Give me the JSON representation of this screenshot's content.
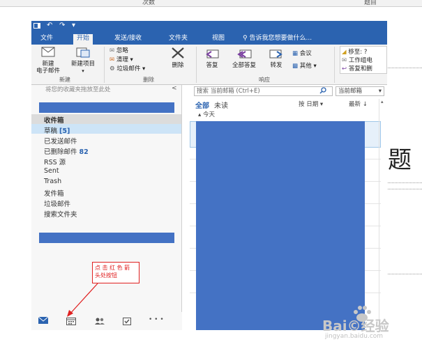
{
  "top_strip": {
    "left_text": "次数",
    "right_text": "题目"
  },
  "title_bar": {
    "icons": [
      "↶",
      "↷",
      "▾"
    ]
  },
  "tabs": [
    {
      "label": "文件",
      "active": false
    },
    {
      "label": "开始",
      "active": true
    },
    {
      "label": "发送/接收",
      "active": false
    },
    {
      "label": "文件夹",
      "active": false
    },
    {
      "label": "视图",
      "active": false
    },
    {
      "label": "告诉我您想要做什么...",
      "active": false
    }
  ],
  "ribbon": {
    "new_email": "新建\n电子邮件",
    "new_item": "新建项目",
    "group_new": "新建",
    "ignore": "忽略",
    "cleanup": "清理",
    "junk": "垃圾邮件",
    "delete": "删除",
    "group_delete": "删除",
    "reply": "答复",
    "reply_all": "全部答复",
    "forward": "转发",
    "meeting": "会议",
    "other": "其他",
    "group_respond": "响应",
    "move_to": "移至: ?",
    "team_email": "工作组电",
    "reply_delete": "答复和删"
  },
  "folder_pane": {
    "favorites_hint": "将您的收藏夹拖放至此处",
    "collapse_glyph": "<",
    "folders": [
      {
        "label": "收件箱",
        "count": ""
      },
      {
        "label": "草稿",
        "count": "[5]"
      },
      {
        "label": "已发送邮件",
        "count": ""
      },
      {
        "label": "已删除邮件",
        "count": "82"
      },
      {
        "label": "RSS 源",
        "count": ""
      },
      {
        "label": "Sent",
        "count": ""
      },
      {
        "label": "Trash",
        "count": ""
      },
      {
        "label": "发件箱",
        "count": ""
      },
      {
        "label": "垃圾邮件",
        "count": ""
      },
      {
        "label": "搜索文件夹",
        "count": ""
      }
    ]
  },
  "nav": {
    "more": "• • •"
  },
  "message_list": {
    "search_placeholder": "搜索 当前邮箱 (Ctrl+E)",
    "scope": "当前邮箱",
    "filter_all": "全部",
    "filter_unread": "未读",
    "sort_by": "按 日期",
    "sort_order": "最新 ↓",
    "group_today": "▴ 今天"
  },
  "right_artifact": {
    "char": "题"
  },
  "annotation": {
    "text": "点 击 红 色 箭\n头处按钮"
  },
  "watermark": {
    "brand": "Bai©经验",
    "url": "jingyan.baidu.com"
  },
  "colors": {
    "accent": "#2b63b0",
    "redact": "#4472c4",
    "note": "#e02020"
  }
}
